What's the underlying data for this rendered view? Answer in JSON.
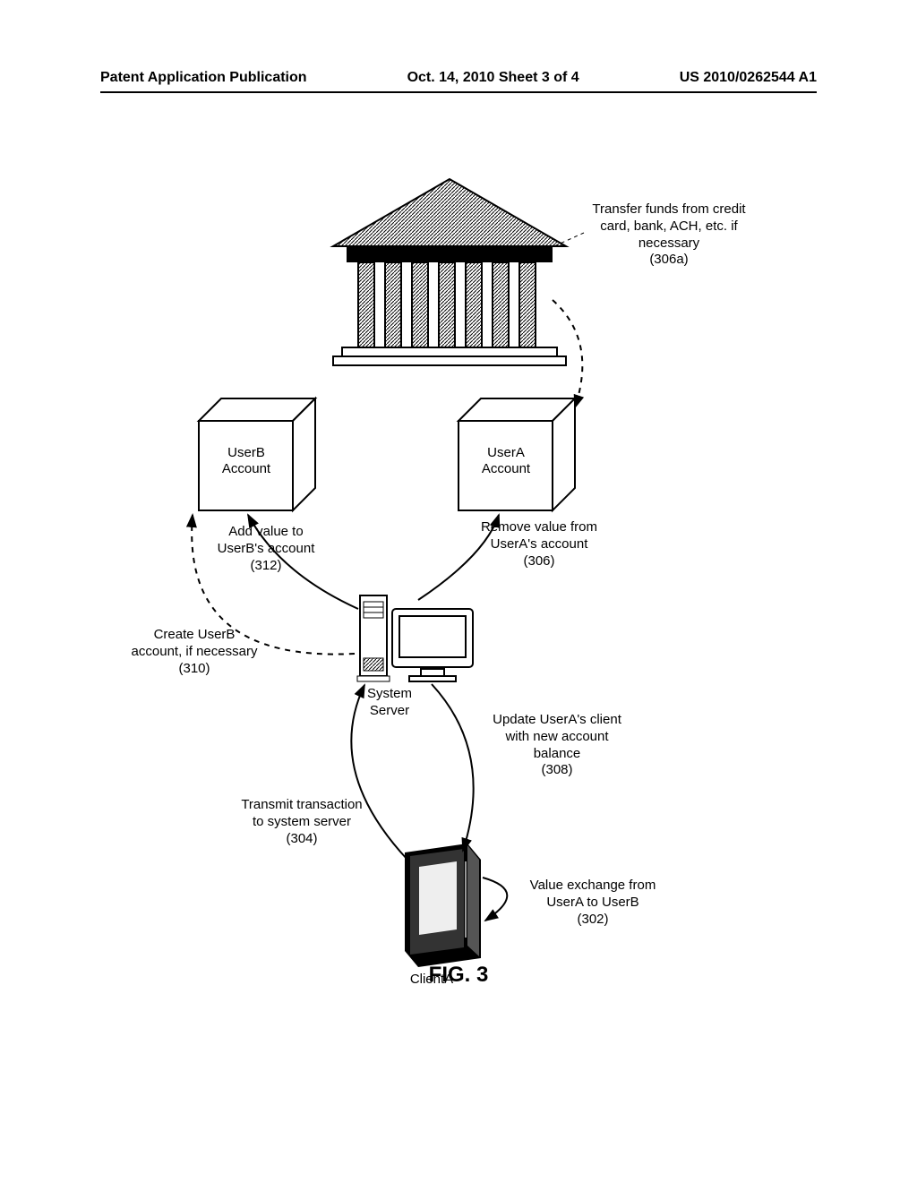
{
  "header": {
    "left": "Patent Application Publication",
    "center": "Oct. 14, 2010  Sheet 3 of 4",
    "right": "US 2010/0262544 A1"
  },
  "figure_label": "FIG. 3",
  "boxes": {
    "userB": "UserB\nAccount",
    "userA": "UserA\nAccount"
  },
  "labels": {
    "system_server": "System\nServer",
    "client_a": "ClientA"
  },
  "annotations": {
    "a302": "Value exchange from\nUserA to UserB\n(302)",
    "a304": "Transmit transaction\nto system server\n(304)",
    "a306": "Remove value from\nUserA's account\n(306)",
    "a306a": "Transfer funds from credit\ncard, bank, ACH, etc. if\nnecessary\n(306a)",
    "a308": "Update UserA's client\nwith new account\nbalance\n(308)",
    "a310": "Create UserB\naccount, if necessary\n(310)",
    "a312": "Add value to\nUserB's account\n(312)"
  }
}
